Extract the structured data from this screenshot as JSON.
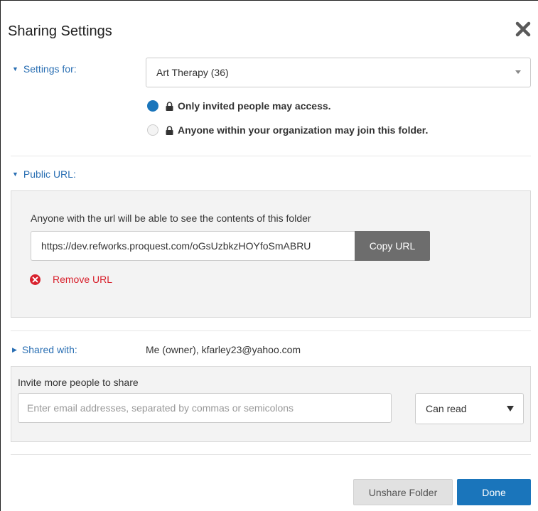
{
  "dialog": {
    "title": "Sharing Settings",
    "close_icon": "close-icon"
  },
  "settings_for": {
    "label": "Settings for:",
    "selected_folder": "Art Therapy (36)",
    "options": [
      {
        "label": "Only invited people may access.",
        "selected": true,
        "icon": "lock-icon"
      },
      {
        "label": "Anyone within your organization may join this folder.",
        "selected": false,
        "icon": "lock-icon"
      }
    ]
  },
  "public_url": {
    "label": "Public URL:",
    "description": "Anyone with the url will be able to see the contents of this folder",
    "url": "https://dev.refworks.proquest.com/oGsUzbkzHOYfoSmABRU",
    "copy_label": "Copy URL",
    "remove_label": "Remove URL",
    "remove_icon": "remove-circle-icon"
  },
  "shared_with": {
    "label": "Shared with:",
    "value": "Me (owner), kfarley23@yahoo.com"
  },
  "invite": {
    "heading": "Invite more people to share",
    "placeholder": "Enter email addresses, separated by commas or semicolons",
    "permission": "Can read"
  },
  "footer": {
    "unshare_label": "Unshare Folder",
    "done_label": "Done"
  },
  "colors": {
    "accent": "#1a75bb",
    "link": "#2a6fb3",
    "danger": "#d8212d",
    "panel_bg": "#f3f3f3"
  }
}
